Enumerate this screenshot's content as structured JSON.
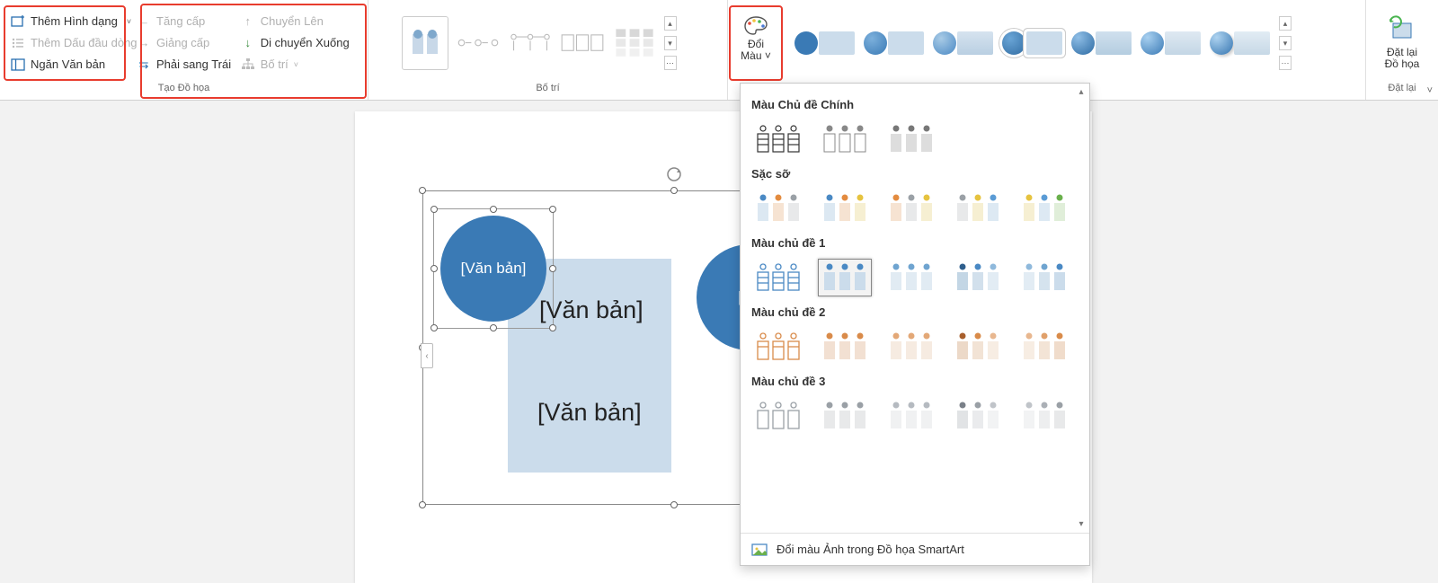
{
  "ribbon": {
    "create_graphic": {
      "add_shape": "Thêm Hình dạng",
      "add_bullet": "Thêm Dấu đầu dòng",
      "text_pane": "Ngăn Văn bản",
      "promote": "Tăng cấp",
      "demote": "Giảng cấp",
      "rtl": "Phải sang Trái",
      "move_up": "Chuyển Lên",
      "move_down": "Di chuyển Xuống",
      "layout_btn": "Bố trí",
      "group_label": "Tạo Đồ họa"
    },
    "layouts": {
      "group_label": "Bố trí"
    },
    "change_colors": {
      "label_line1": "Đổi",
      "label_line2": "Màu"
    },
    "reset": {
      "label_line1": "Đặt lại",
      "label_line2": "Đồ họa",
      "group_label": "Đặt lại"
    }
  },
  "canvas": {
    "shape_text1": "[Văn bản]",
    "shape_text2": "[Vă",
    "inner_text1": "[Văn bản]",
    "inner_text2": "[Văn bản]"
  },
  "dropdown": {
    "section1": "Màu Chủ đề Chính",
    "section2": "Sặc sỡ",
    "section3": "Màu chủ đề 1",
    "section4": "Màu chủ đề 2",
    "section5": "Màu chủ đề 3",
    "footer": "Đổi màu Ảnh trong Đồ họa SmartArt"
  }
}
